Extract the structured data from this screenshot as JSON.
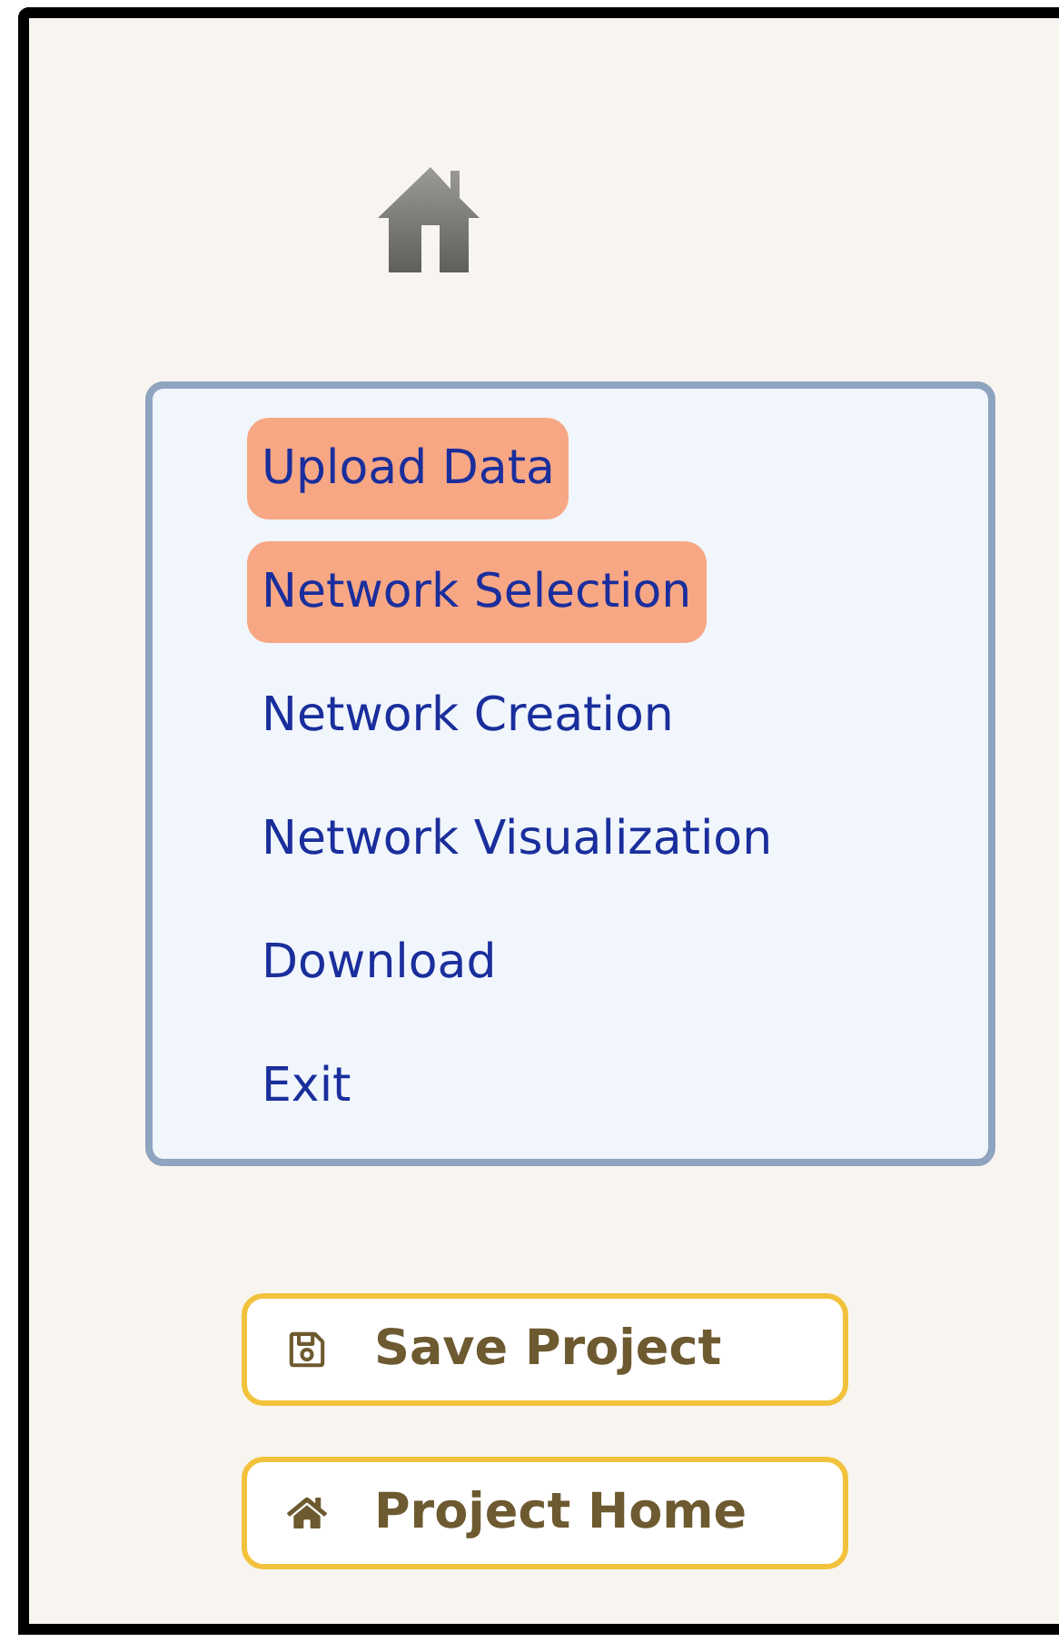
{
  "menu": {
    "items": [
      {
        "label": "Upload Data",
        "highlighted": true
      },
      {
        "label": "Network Selection",
        "highlighted": true
      },
      {
        "label": "Network Creation",
        "highlighted": false
      },
      {
        "label": "Network Visualization",
        "highlighted": false
      },
      {
        "label": "Download",
        "highlighted": false
      },
      {
        "label": "Exit",
        "highlighted": false
      }
    ]
  },
  "buttons": [
    {
      "label": "Save Project",
      "kind": "save"
    },
    {
      "label": "Project Home",
      "kind": "home"
    }
  ]
}
